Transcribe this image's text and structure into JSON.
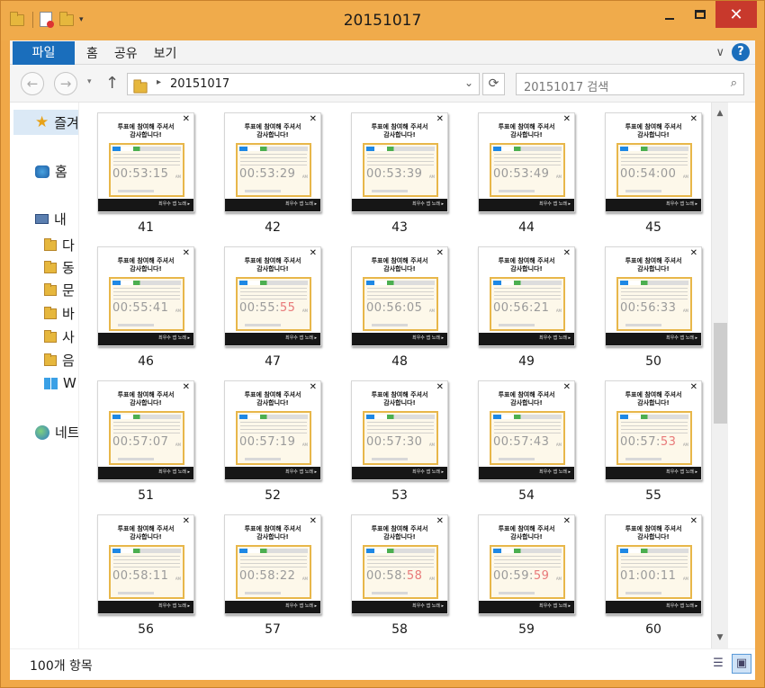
{
  "window": {
    "title": "20151017"
  },
  "quick_access": {
    "dropdown": "▾"
  },
  "controls": {
    "minimize": "",
    "maximize": "",
    "close": "✕"
  },
  "ribbon": {
    "file_tab": "파일",
    "tabs": [
      "홈",
      "공유",
      "보기"
    ],
    "collapse": "∨",
    "help": "?"
  },
  "address": {
    "back": "←",
    "forward": "→",
    "history": "▾",
    "up": "↑",
    "separator": "▸",
    "path": "20151017",
    "dropdown": "⌄",
    "refresh": "⟳",
    "search_placeholder": "20151017 검색",
    "search_icon": "⌕"
  },
  "nav_pane": {
    "favorites": "즐겨",
    "homegroup": "홈",
    "this_pc": "내",
    "items": [
      "다",
      "동",
      "문",
      "바",
      "사",
      "음",
      "W"
    ],
    "network": "네트"
  },
  "thumbnail": {
    "message": [
      "투표에 참여해 주셔서",
      "감사합니다!"
    ],
    "close": "✕",
    "footer": "최우수 앱 노래 ▸",
    "am": "AM"
  },
  "files": [
    {
      "name": "41",
      "time": "00:53:15",
      "red": ""
    },
    {
      "name": "42",
      "time": "00:53:29",
      "red": ""
    },
    {
      "name": "43",
      "time": "00:53:39",
      "red": ""
    },
    {
      "name": "44",
      "time": "00:53:49",
      "red": ""
    },
    {
      "name": "45",
      "time": "00:54:00",
      "red": ""
    },
    {
      "name": "46",
      "time": "00:55:41",
      "red": ""
    },
    {
      "name": "47",
      "time": "00:55:",
      "red": "55"
    },
    {
      "name": "48",
      "time": "00:56:05",
      "red": ""
    },
    {
      "name": "49",
      "time": "00:56:21",
      "red": ""
    },
    {
      "name": "50",
      "time": "00:56:33",
      "red": ""
    },
    {
      "name": "51",
      "time": "00:57:07",
      "red": ""
    },
    {
      "name": "52",
      "time": "00:57:19",
      "red": ""
    },
    {
      "name": "53",
      "time": "00:57:30",
      "red": ""
    },
    {
      "name": "54",
      "time": "00:57:43",
      "red": ""
    },
    {
      "name": "55",
      "time": "00:57:",
      "red": "53"
    },
    {
      "name": "56",
      "time": "00:58:11",
      "red": ""
    },
    {
      "name": "57",
      "time": "00:58:22",
      "red": ""
    },
    {
      "name": "58",
      "time": "00:58:",
      "red": "58"
    },
    {
      "name": "59",
      "time": "00:59:",
      "red": "59"
    },
    {
      "name": "60",
      "time": "01:00:11",
      "red": ""
    }
  ],
  "scroll": {
    "up": "▲",
    "down": "▼"
  },
  "status": {
    "item_count": "100개 항목",
    "details_view": "☰",
    "large_icons_view": "▣"
  }
}
